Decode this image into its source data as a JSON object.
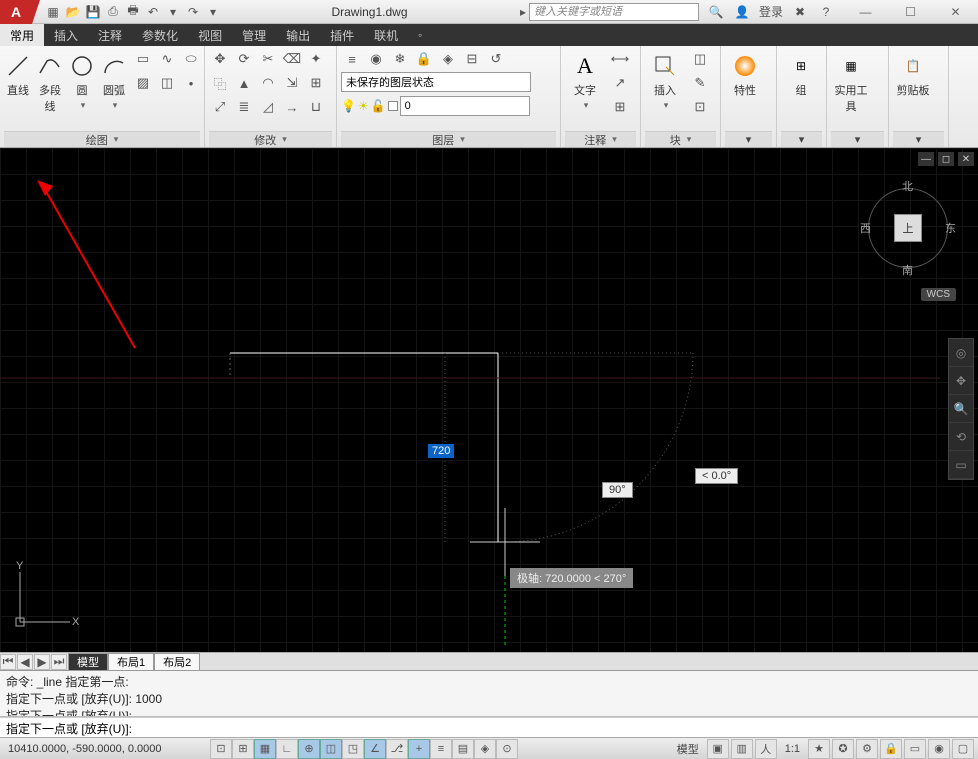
{
  "title": "Drawing1.dwg",
  "search_placeholder": "键入关键字或短语",
  "login": "登录",
  "tabs": [
    "常用",
    "插入",
    "注释",
    "参数化",
    "视图",
    "管理",
    "输出",
    "插件",
    "联机"
  ],
  "active_tab": 0,
  "panels": {
    "draw": {
      "title": "绘图",
      "line": "直线",
      "polyline": "多段线",
      "circle": "圆",
      "arc": "圆弧"
    },
    "modify": {
      "title": "修改"
    },
    "layers": {
      "title": "图层",
      "state": "未保存的图层状态",
      "current": "0"
    },
    "annot": {
      "title": "注释",
      "text": "文字"
    },
    "block": {
      "title": "块",
      "insert": "插入"
    },
    "props": {
      "title": "特性"
    },
    "group": {
      "title": "组"
    },
    "util": {
      "title": "实用工具"
    },
    "clip": {
      "title": "剪贴板"
    }
  },
  "viewcube": {
    "n": "北",
    "s": "南",
    "e": "东",
    "w": "西",
    "top": "上"
  },
  "wcs": "WCS",
  "canvas": {
    "input_value": "720",
    "angle1": "90°",
    "angle2": "< 0.0°",
    "polar": "极轴: 720.0000 < 270°"
  },
  "ucs": {
    "x": "X",
    "y": "Y"
  },
  "layout_tabs": [
    "模型",
    "布局1",
    "布局2"
  ],
  "cmd_history": "命令: _line 指定第一点:\n指定下一点或 [放弃(U)]: 1000\n指定下一点或 [放弃(U)]:",
  "cmd_prompt": "指定下一点或 [放弃(U)]:",
  "status": {
    "coords": "10410.0000, -590.0000, 0.0000",
    "model": "模型",
    "scale": "1:1"
  }
}
